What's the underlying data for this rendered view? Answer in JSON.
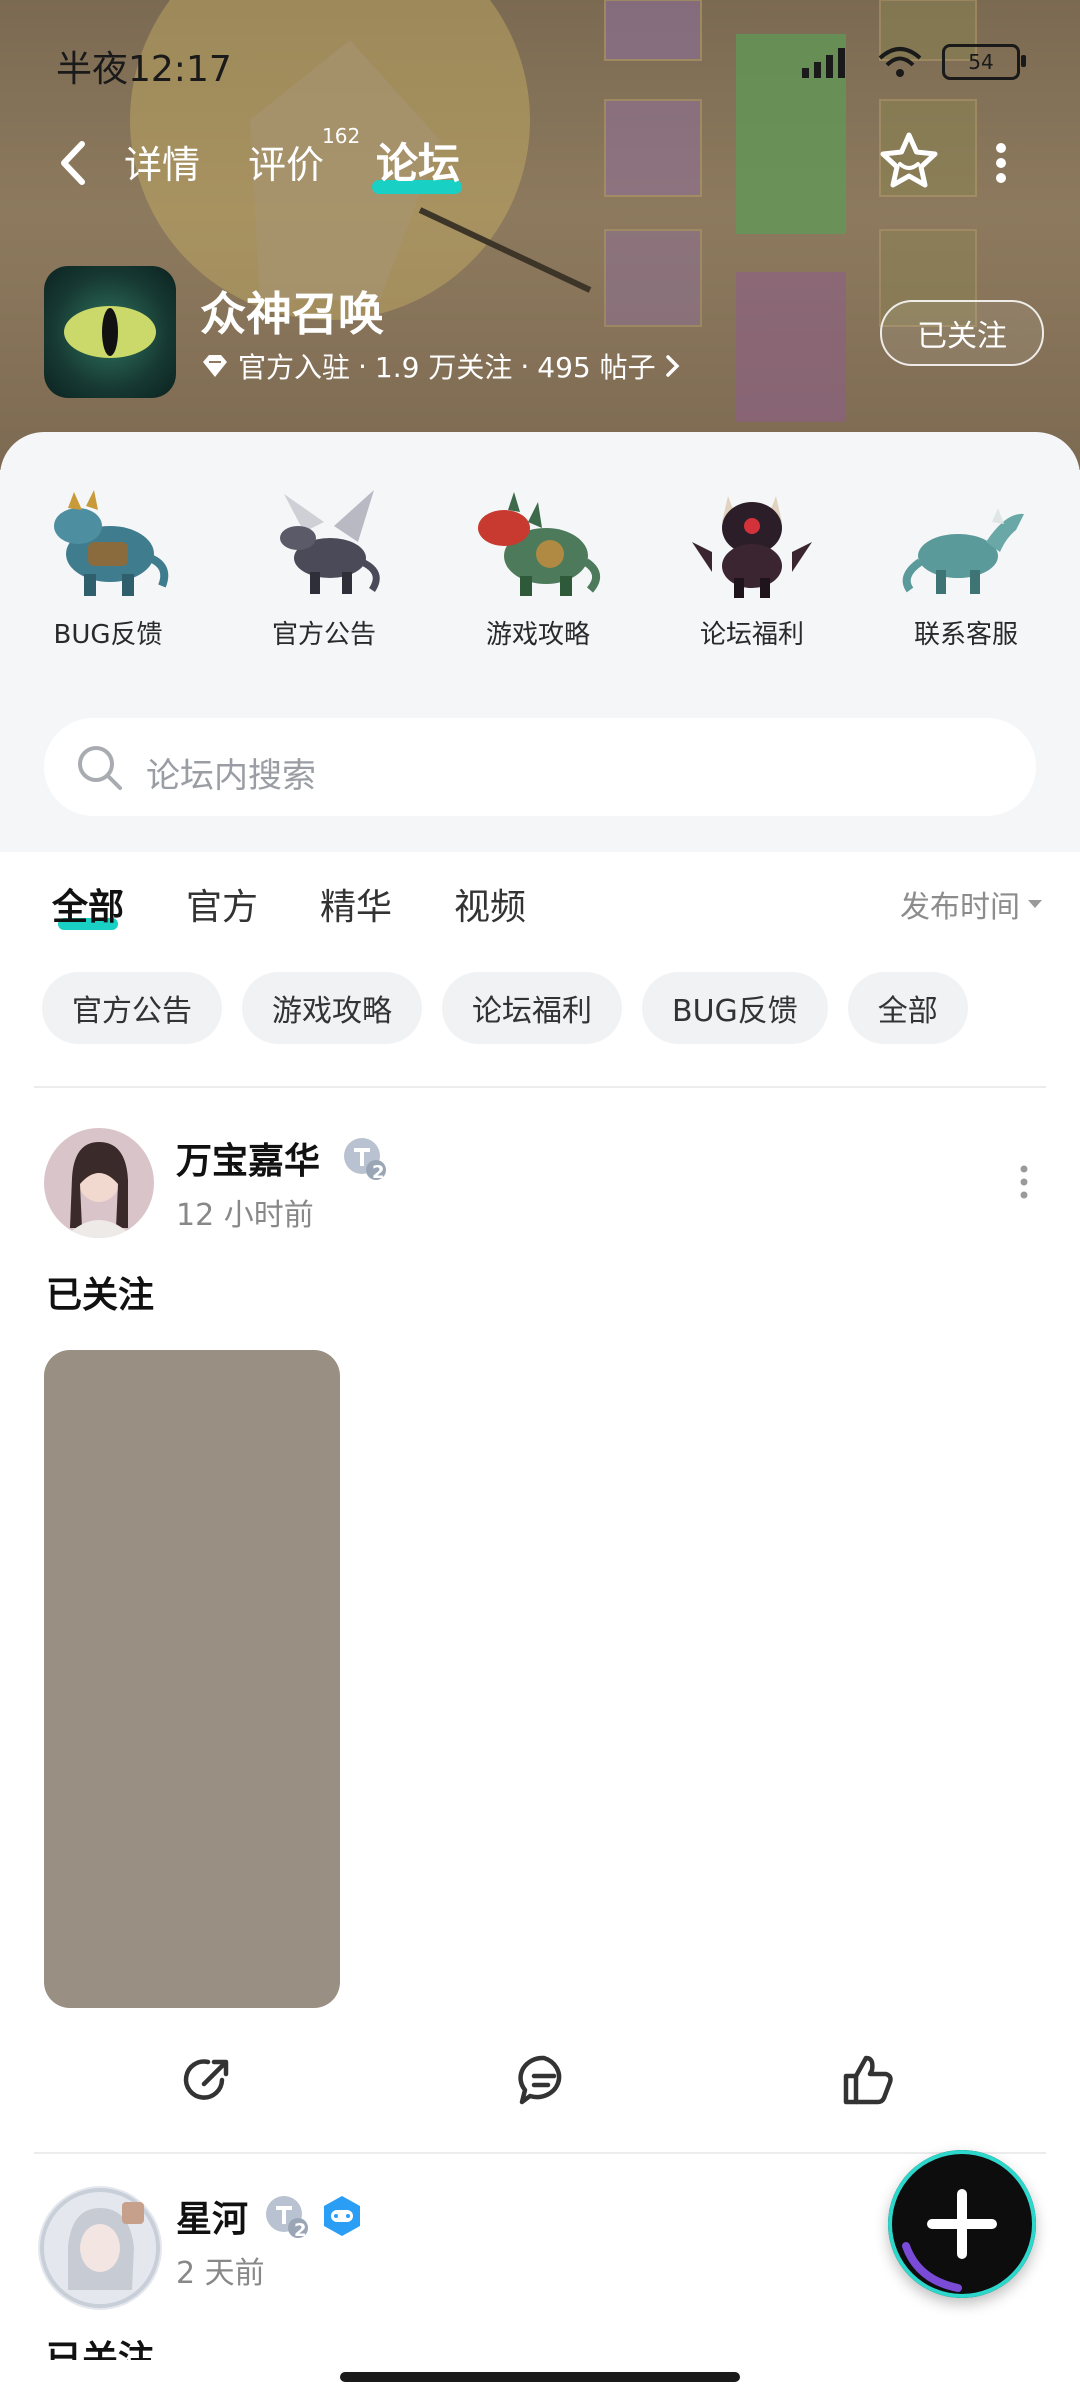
{
  "status_bar": {
    "time": "半夜12:17",
    "battery": "54"
  },
  "nav": {
    "tabs": [
      {
        "label": "详情"
      },
      {
        "label": "评价",
        "count": "162"
      },
      {
        "label": "论坛"
      }
    ]
  },
  "app": {
    "title": "众神召唤",
    "official_label": "官方入驻",
    "followers": "1.9 万关注",
    "posts": "495 帖子",
    "follow_button": "已关注"
  },
  "categories": [
    {
      "label": "BUG反馈",
      "icon": "blue-dragon-icon"
    },
    {
      "label": "官方公告",
      "icon": "winged-dragon-icon"
    },
    {
      "label": "游戏攻略",
      "icon": "red-dragon-icon"
    },
    {
      "label": "论坛福利",
      "icon": "dark-dragon-icon"
    },
    {
      "label": "联系客服",
      "icon": "teal-dragon-icon"
    }
  ],
  "search": {
    "placeholder": "论坛内搜索"
  },
  "filter_tabs": [
    {
      "label": "全部",
      "active": true
    },
    {
      "label": "官方"
    },
    {
      "label": "精华"
    },
    {
      "label": "视频"
    }
  ],
  "sort_label": "发布时间",
  "chips": [
    "官方公告",
    "游戏攻略",
    "论坛福利",
    "BUG反馈",
    "全部"
  ],
  "posts": [
    {
      "username": "万宝嘉华",
      "level": "2",
      "time": "12 小时前",
      "body": "已关注"
    },
    {
      "username": "星河",
      "level": "2",
      "time": "2 天前",
      "body": "已关注"
    }
  ],
  "colors": {
    "accent": "#19d0c4",
    "chip_bg": "#f1f2f3",
    "sheet_bg": "#f4f6f8"
  }
}
